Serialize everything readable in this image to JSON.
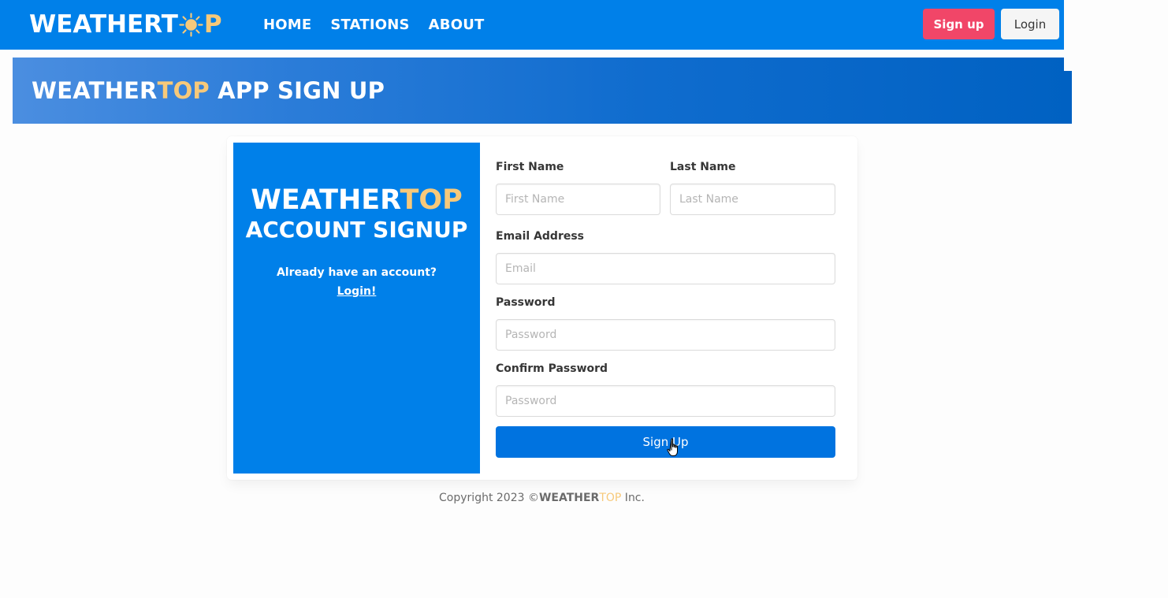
{
  "navbar": {
    "brand_part1": "WEATHERT",
    "brand_part2": "P",
    "links": [
      "HOME",
      "STATIONS",
      "ABOUT"
    ],
    "signup_label": "Sign up",
    "login_label": "Login"
  },
  "hero": {
    "title_part1": "WEATHER",
    "title_part2": "TOP",
    "title_part3": " APP SIGN UP"
  },
  "side": {
    "brand_part1": "WEATHER",
    "brand_part2": "TOP",
    "subtitle": "ACCOUNT SIGNUP",
    "question": "Already have an account?",
    "login_link": "Login!"
  },
  "form": {
    "first_name_label": "First Name",
    "first_name_placeholder": "First Name",
    "last_name_label": "Last Name",
    "last_name_placeholder": "Last Name",
    "email_label": "Email Address",
    "email_placeholder": "Email",
    "password_label": "Password",
    "password_placeholder": "Password",
    "confirm_label": "Confirm Password",
    "confirm_placeholder": "Password",
    "submit_label": "Sign Up"
  },
  "footer": {
    "prefix": "Copyright 2023 ©",
    "brand_part1": "WEATHER",
    "brand_part2": "TOP",
    "suffix": " Inc."
  },
  "colors": {
    "primary": "#0080e9",
    "accent": "#f7c97a",
    "danger": "#f14668",
    "submit": "#0073e0"
  }
}
